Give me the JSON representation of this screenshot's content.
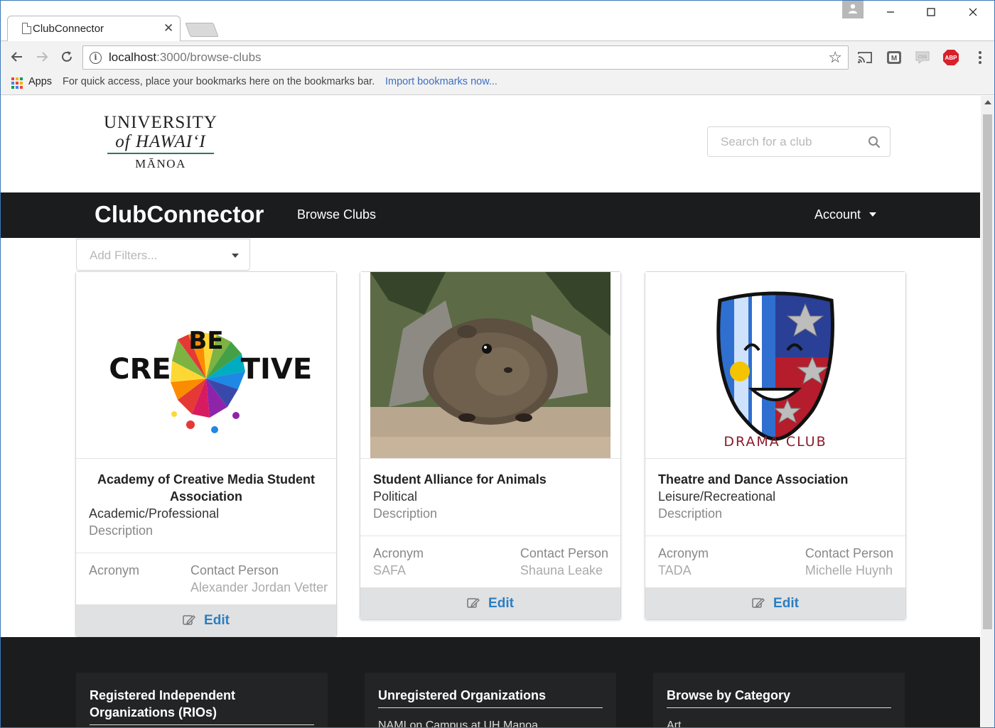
{
  "browser": {
    "tab_title": "ClubConnector",
    "url_host": "localhost",
    "url_rest": ":3000/browse-clubs",
    "bookmarks": {
      "apps_label": "Apps",
      "hint_text": "For quick access, place your bookmarks here on the bookmarks bar.",
      "import_link": "Import bookmarks now..."
    }
  },
  "header": {
    "logo_line1": "UNIVERSITY",
    "logo_line2": "of HAWAI‘I",
    "logo_line3": "MĀNOA",
    "search_placeholder": "Search for a club"
  },
  "navbar": {
    "brand": "ClubConnector",
    "browse_label": "Browse Clubs",
    "account_label": "Account"
  },
  "filter": {
    "placeholder": "Add Filters..."
  },
  "cards": [
    {
      "name": "Academy of Creative Media Student Association",
      "category": "Academic/Professional",
      "description": "Description",
      "acronym_label": "Acronym",
      "acronym": "",
      "contact_label": "Contact Person",
      "contact": "Alexander Jordan Vetter",
      "edit_label": "Edit",
      "image_icon": "be-creative-logo"
    },
    {
      "name": "Student Alliance for Animals",
      "category": "Political",
      "description": "Description",
      "acronym_label": "Acronym",
      "acronym": "SAFA",
      "contact_label": "Contact Person",
      "contact": "Shauna Leake",
      "edit_label": "Edit",
      "image_icon": "guinea-pig-photo"
    },
    {
      "name": "Theatre and Dance Association",
      "category": "Leisure/Recreational",
      "description": "Description",
      "acronym_label": "Acronym",
      "acronym": "TADA",
      "contact_label": "Contact Person",
      "contact": "Michelle Huynh",
      "edit_label": "Edit",
      "image_icon": "drama-club-mask",
      "image_text": "DRAMA CLUB"
    }
  ],
  "footer": {
    "sections": [
      {
        "title": "Registered Independent Organizations (RIOs)",
        "first_item": ""
      },
      {
        "title": "Unregistered Organizations",
        "first_item": "NAMI on Campus at UH Manoa"
      },
      {
        "title": "Browse by Category",
        "first_item": "Art"
      }
    ]
  },
  "colors": {
    "navbar_bg": "#1b1c1d",
    "link_blue": "#2a7ec2",
    "button_bg": "#e0e1e2",
    "logo_green": "#2d7a5a"
  }
}
